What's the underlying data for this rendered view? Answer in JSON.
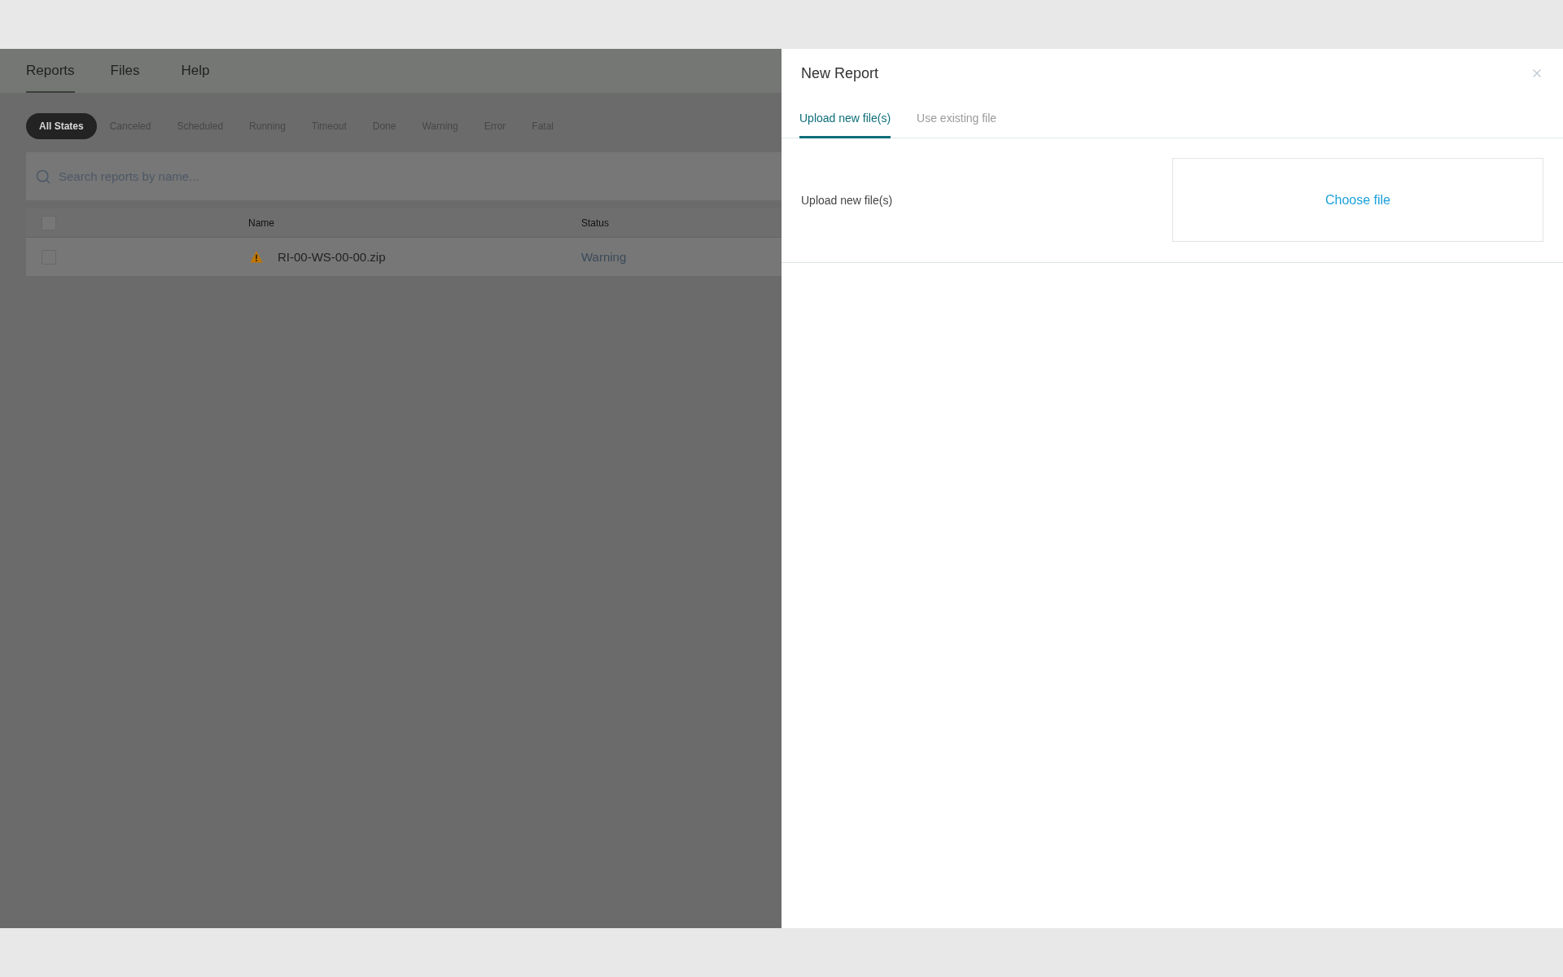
{
  "nav": {
    "tabs": [
      {
        "label": "Reports",
        "selected": true
      },
      {
        "label": "Files",
        "selected": false
      },
      {
        "label": "Help",
        "selected": false
      }
    ]
  },
  "filters": [
    {
      "label": "All States",
      "selected": true
    },
    {
      "label": "Canceled",
      "selected": false
    },
    {
      "label": "Scheduled",
      "selected": false
    },
    {
      "label": "Running",
      "selected": false
    },
    {
      "label": "Timeout",
      "selected": false
    },
    {
      "label": "Done",
      "selected": false
    },
    {
      "label": "Warning",
      "selected": false
    },
    {
      "label": "Error",
      "selected": false
    },
    {
      "label": "Fatal",
      "selected": false
    }
  ],
  "search": {
    "placeholder": "Search reports by name..."
  },
  "table": {
    "header_checked": false,
    "columns": [
      "Name",
      "Status"
    ],
    "rows": [
      {
        "checked": false,
        "kind": "warning",
        "name": "RI-00-WS-00-00.zip",
        "status": "Warning"
      }
    ]
  },
  "drawer": {
    "title": "New Report",
    "tabs": [
      {
        "label": "Upload new file(s)",
        "selected": true
      },
      {
        "label": "Use existing file",
        "selected": false
      }
    ],
    "upload": {
      "label": "Upload new file(s)",
      "action": "Choose file"
    }
  }
}
